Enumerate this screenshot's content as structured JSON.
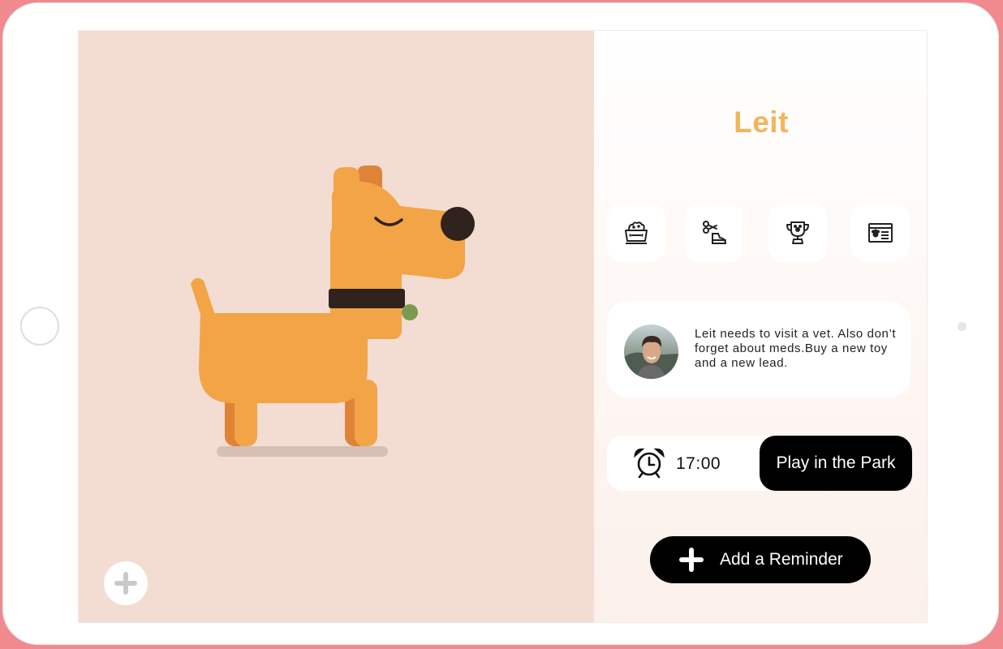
{
  "pet": {
    "name": "Leit"
  },
  "categories": [
    {
      "icon": "food-bowl-icon"
    },
    {
      "icon": "grooming-icon"
    },
    {
      "icon": "trophy-icon"
    },
    {
      "icon": "pet-id-card-icon"
    }
  ],
  "note": {
    "text": "Leit needs to visit a vet. Also don’t forget about meds.Buy a new toy and a new  lead."
  },
  "reminder": {
    "time": "17:00",
    "activity": "Play in the Park"
  },
  "actions": {
    "add_reminder": "Add a Reminder"
  },
  "colors": {
    "accent": "#f3b45a",
    "left_panel": "#f3ddd3",
    "dog": "#f2a446"
  }
}
